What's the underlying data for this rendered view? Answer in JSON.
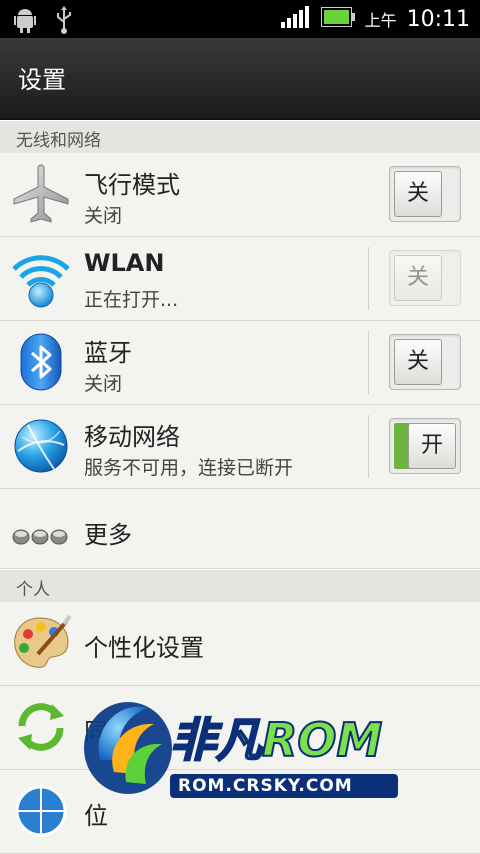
{
  "status_bar": {
    "ampm": "上午",
    "time": "10:11"
  },
  "action_bar": {
    "title": "设置"
  },
  "sections": {
    "wireless": "无线和网络",
    "personal": "个人"
  },
  "rows": {
    "airplane": {
      "title": "飞行模式",
      "sub": "关闭",
      "toggle": "关"
    },
    "wlan": {
      "title": "WLAN",
      "sub": "正在打开...",
      "toggle": "关"
    },
    "bluetooth": {
      "title": "蓝牙",
      "sub": "关闭",
      "toggle": "关"
    },
    "mobile": {
      "title": "移动网络",
      "sub": "服务不可用，连接已断开",
      "toggle": "开"
    },
    "more": {
      "title": "更多"
    },
    "personalize": {
      "title": "个性化设置"
    },
    "sync": {
      "title": "同"
    },
    "location": {
      "title": "位"
    }
  },
  "watermark": {
    "brand": "非凡ROM",
    "url": "ROM.CRSKY.COM"
  },
  "colors": {
    "accent_green": "#6cb33f",
    "section_bg": "#e4e4e0",
    "row_bg": "#f3f3ef"
  }
}
